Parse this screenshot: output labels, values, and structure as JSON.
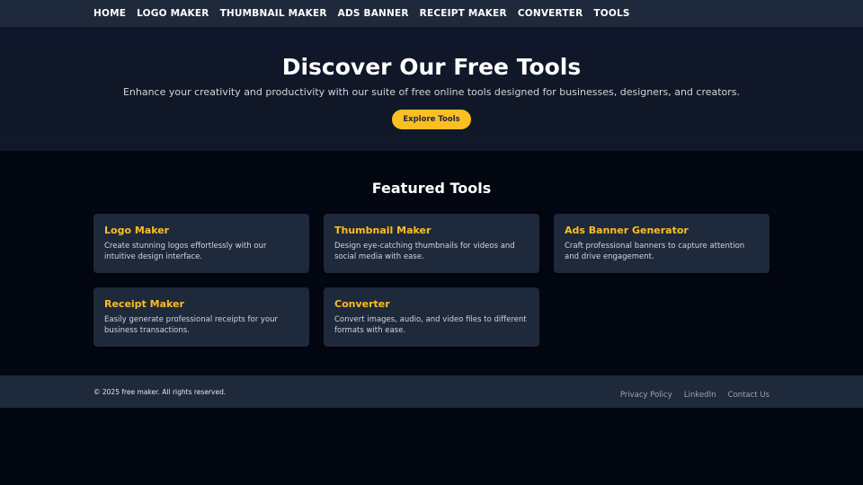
{
  "nav": {
    "items": [
      "HOME",
      "LOGO MAKER",
      "THUMBNAIL MAKER",
      "ADS BANNER",
      "RECEIPT MAKER",
      "CONVERTER",
      "TOOLS"
    ]
  },
  "hero": {
    "title": "Discover Our Free Tools",
    "subtitle": "Enhance your creativity and productivity with our suite of free online tools designed for businesses, designers, and creators.",
    "cta_label": "Explore Tools"
  },
  "featured": {
    "heading": "Featured Tools",
    "cards": [
      {
        "title": "Logo Maker",
        "description": "Create stunning logos effortlessly with our intuitive design interface."
      },
      {
        "title": "Thumbnail Maker",
        "description": "Design eye-catching thumbnails for videos and social media with ease."
      },
      {
        "title": "Ads Banner Generator",
        "description": "Craft professional banners to capture attention and drive engagement."
      },
      {
        "title": "Receipt Maker",
        "description": "Easily generate professional receipts for your business transactions."
      },
      {
        "title": "Converter",
        "description": "Convert images, audio, and video files to different formats with ease."
      }
    ]
  },
  "footer": {
    "copyright": "© 2025 free maker. All rights reserved.",
    "links": [
      "Privacy Policy",
      "LinkedIn",
      "Contact Us"
    ]
  },
  "colors": {
    "accent": "#fbbf24",
    "nav_bg": "#1e293b",
    "page_bg": "#030712",
    "card_bg": "#1e293b"
  }
}
